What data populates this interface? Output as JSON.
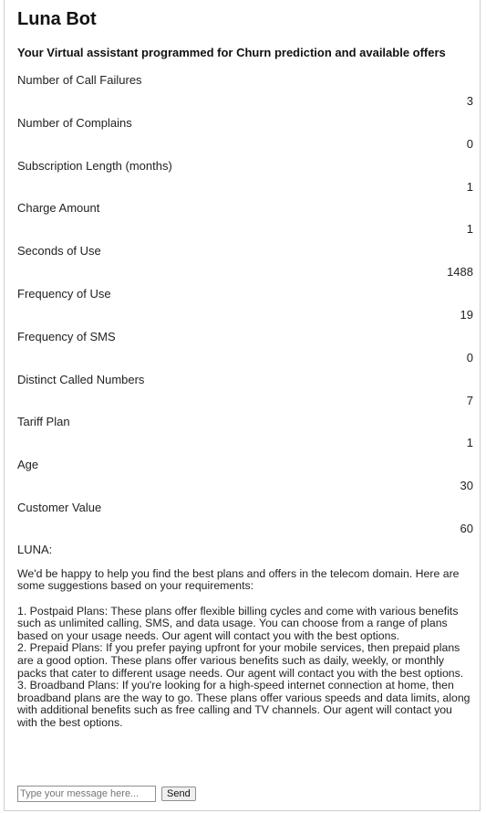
{
  "app": {
    "title": "Luna Bot",
    "subtitle": "Your Virtual assistant programmed for Churn prediction and available offers"
  },
  "messages": [
    {
      "question": "Number of Call Failures",
      "answer": "3"
    },
    {
      "question": "Number of Complains",
      "answer": "0"
    },
    {
      "question": "Subscription Length (months)",
      "answer": "1"
    },
    {
      "question": "Charge Amount",
      "answer": "1"
    },
    {
      "question": "Seconds of Use",
      "answer": "1488"
    },
    {
      "question": "Frequency of Use",
      "answer": "19"
    },
    {
      "question": "Frequency of SMS",
      "answer": "0"
    },
    {
      "question": "Distinct Called Numbers",
      "answer": "7"
    },
    {
      "question": "Tariff Plan",
      "answer": "1"
    },
    {
      "question": "Age",
      "answer": "30"
    },
    {
      "question": "Customer Value",
      "answer": "60"
    }
  ],
  "luna": {
    "label": "LUNA:",
    "reply": "We'd be happy to help you find the best plans and offers in the telecom domain. Here are some suggestions based on your requirements:\n\n1. Postpaid Plans: These plans offer flexible billing cycles and come with various benefits such as unlimited calling, SMS, and data usage. You can choose from a range of plans based on your usage needs. Our agent will contact you with the best options.\n2. Prepaid Plans: If you prefer paying upfront for your mobile services, then prepaid plans are a good option. These plans offer various benefits such as daily, weekly, or monthly packs that cater to different usage needs. Our agent will contact you with the best options.\n3. Broadband Plans: If you're looking for a high-speed internet connection at home, then broadband plans are the way to go. These plans offer various speeds and data limits, along with additional benefits such as free calling and TV channels. Our agent will contact you with the best options."
  },
  "input": {
    "placeholder": "Type your message here...",
    "value": "",
    "send_label": "Send"
  }
}
